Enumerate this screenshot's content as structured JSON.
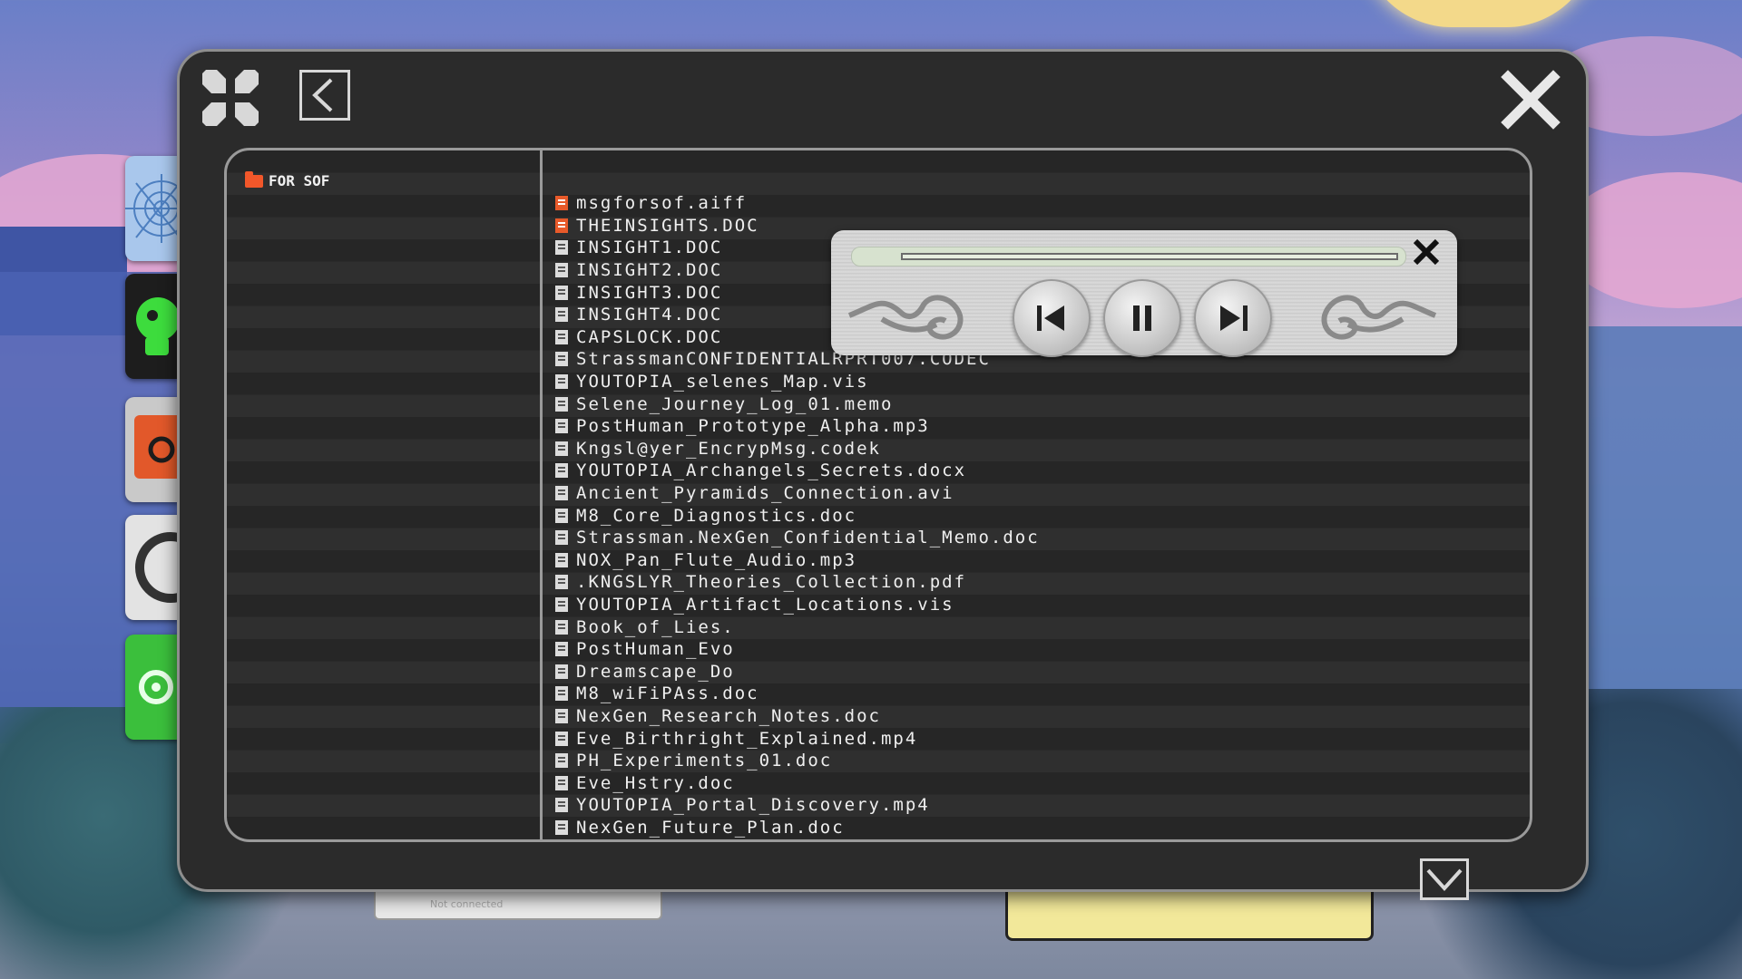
{
  "folder_tree": {
    "items": [
      {
        "label": "FOR SOF",
        "icon": "folder-icon"
      }
    ]
  },
  "files": [
    {
      "name": "msgforsof.aiff",
      "icon": "audio-file-icon",
      "highlight": true
    },
    {
      "name": "THEINSIGHTS.DOC",
      "icon": "image-file-icon",
      "highlight": true
    },
    {
      "name": "INSIGHT1.DOC",
      "icon": "document-icon"
    },
    {
      "name": "INSIGHT2.DOC",
      "icon": "document-icon"
    },
    {
      "name": "INSIGHT3.DOC",
      "icon": "document-icon"
    },
    {
      "name": "INSIGHT4.DOC",
      "icon": "document-icon"
    },
    {
      "name": "CAPSLOCK.DOC",
      "icon": "document-icon"
    },
    {
      "name": "StrassmanCONFIDENTIALRPRT007.CODEC",
      "icon": "video-file-icon"
    },
    {
      "name": "YOUTOPIA_selenes_Map.vis",
      "icon": "image-file-icon"
    },
    {
      "name": "Selene_Journey_Log_01.memo",
      "icon": "image-file-icon"
    },
    {
      "name": "PostHuman_Prototype_Alpha.mp3",
      "icon": "audio-file-icon"
    },
    {
      "name": "Kngsl@yer_EncrypMsg.codek",
      "icon": "video-file-icon"
    },
    {
      "name": "YOUTOPIA_Archangels_Secrets.docx",
      "icon": "document-icon"
    },
    {
      "name": "Ancient_Pyramids_Connection.avi",
      "icon": "video-file-icon"
    },
    {
      "name": "M8_Core_Diagnostics.doc",
      "icon": "audio-file-icon"
    },
    {
      "name": "Strassman.NexGen_Confidential_Memo.doc",
      "icon": "document-icon"
    },
    {
      "name": "NOX_Pan_Flute_Audio.mp3",
      "icon": "audio-file-icon"
    },
    {
      "name": ".KNGSLYR_Theories_Collection.pdf",
      "icon": "document-icon"
    },
    {
      "name": "YOUTOPIA_Artifact_Locations.vis",
      "icon": "document-icon"
    },
    {
      "name": "Book_of_Lies.",
      "icon": "document-icon"
    },
    {
      "name": "PostHuman_Evo",
      "icon": "document-icon"
    },
    {
      "name": "Dreamscape_Do",
      "icon": "document-icon"
    },
    {
      "name": "M8_wiFiPAss.doc",
      "icon": "document-icon"
    },
    {
      "name": "NexGen_Research_Notes.doc",
      "icon": "image-file-icon"
    },
    {
      "name": "Eve_Birthright_Explained.mp4",
      "icon": "video-file-icon"
    },
    {
      "name": "PH_Experiments_01.doc",
      "icon": "document-icon"
    },
    {
      "name": "Eve_Hstry.doc",
      "icon": "document-icon"
    },
    {
      "name": "YOUTOPIA_Portal_Discovery.mp4",
      "icon": "video-file-icon"
    },
    {
      "name": "NexGen_Future_Plan.doc",
      "icon": "document-icon"
    }
  ],
  "status_bar": {
    "text": "Not connected"
  },
  "colors": {
    "accent": "#f2572a",
    "window_bg": "#2b2b2b",
    "border": "#9a9a9a"
  },
  "dock": [
    {
      "name": "dock-web-icon",
      "color": "#a9c7ec"
    },
    {
      "name": "dock-skull-icon",
      "color": "#1d1d1d"
    },
    {
      "name": "dock-gear-orange-icon",
      "color": "#e2582a"
    },
    {
      "name": "dock-ring-icon",
      "color": "#e3e3e3"
    },
    {
      "name": "dock-gear-green-icon",
      "color": "#3bbf3c"
    }
  ]
}
